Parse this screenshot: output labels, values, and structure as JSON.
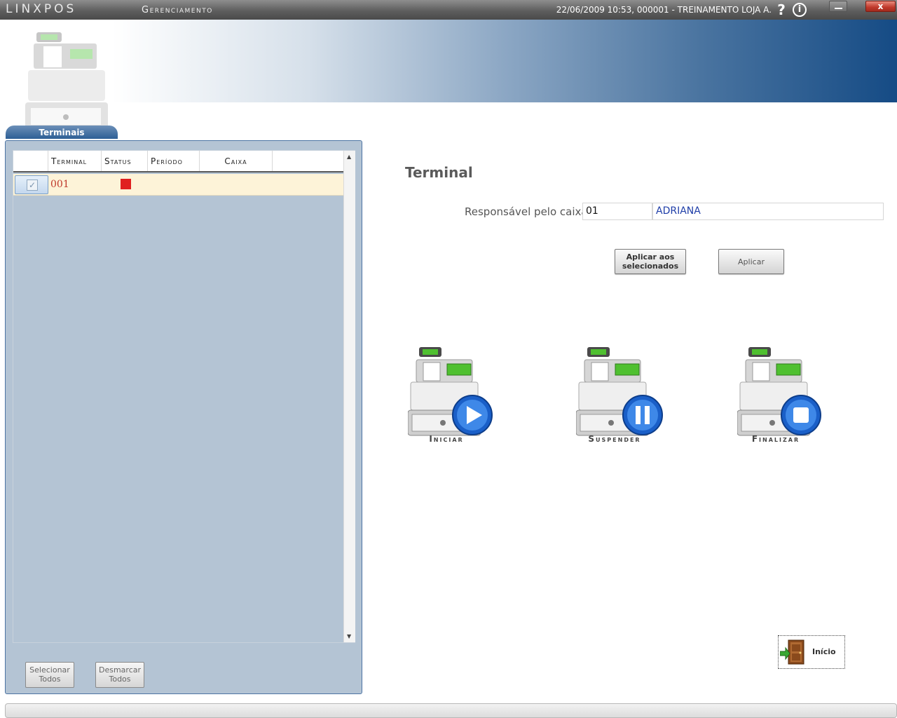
{
  "window": {
    "brand": "LINXPOS",
    "module": "Gerenciamento",
    "session_info": "22/06/2009 10:53, 000001 - TREINAMENTO LOJA A.",
    "help_glyph": "?",
    "info_glyph": "i",
    "close_glyph": "x"
  },
  "tab": {
    "label": "Terminais"
  },
  "grid": {
    "columns": [
      "Terminal",
      "Status",
      "Período",
      "Caixa"
    ],
    "rows": [
      {
        "terminal": "001",
        "status_color": "#e02020",
        "periodo": "",
        "caixa": ""
      }
    ]
  },
  "left_buttons": {
    "select_all": "Selecionar Todos",
    "deselect_all": "Desmarcar Todos"
  },
  "main": {
    "title": "Terminal",
    "responsavel_label": "Responsável pelo caixa",
    "responsavel_code": "01",
    "responsavel_name": "ADRIANA",
    "apply_selected": "Aplicar aos selecionados",
    "apply": "Aplicar",
    "actions": [
      {
        "label": "Iniciar",
        "icon": "play-icon"
      },
      {
        "label": "Suspender",
        "icon": "pause-icon"
      },
      {
        "label": "Finalizar",
        "icon": "stop-icon"
      }
    ],
    "home_label": "Início"
  },
  "colors": {
    "accent_blue": "#154b85",
    "panel_bg": "#b4c4d4",
    "row_highlight": "#fdf3d8",
    "status_red": "#e02020"
  }
}
